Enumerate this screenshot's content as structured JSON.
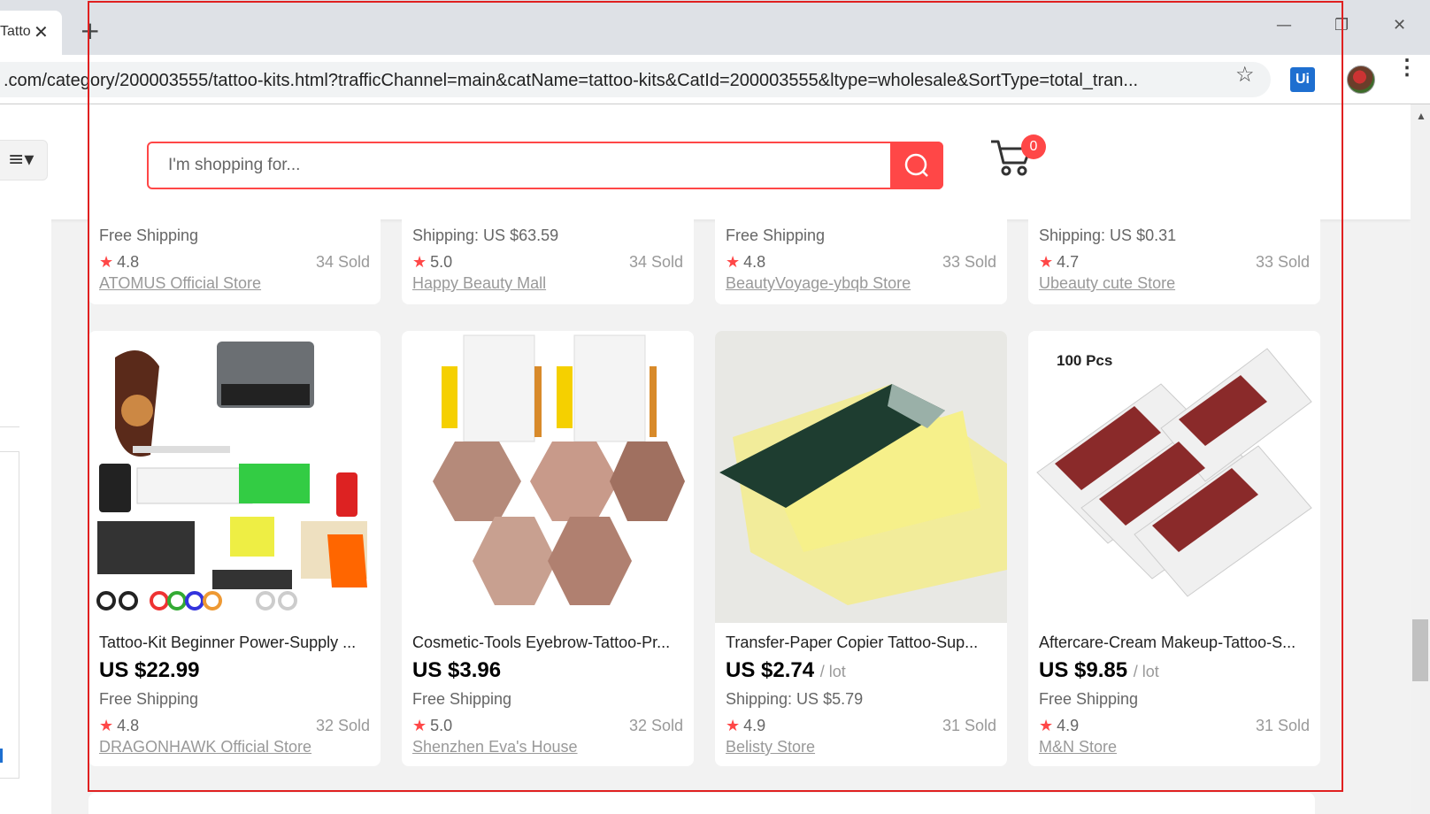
{
  "browser": {
    "tab_title": "Tatto",
    "tab_close": "✕",
    "new_tab": "+",
    "minimize": "—",
    "restore": "❐",
    "close": "✕",
    "url": ".com/category/200003555/tattoo-kits.html?trafficChannel=main&catName=tattoo-kits&CatId=200003555&ltype=wholesale&SortType=total_tran...",
    "bookmark_icon": "star-icon",
    "extension_label": "Ui",
    "menu": "⋮"
  },
  "header": {
    "category_menu_icon": "≡▾",
    "search_placeholder": "I'm shopping for...",
    "cart_count": "0"
  },
  "colors": {
    "accent": "#ff4747",
    "frame": "#e02020"
  },
  "top_cards": [
    {
      "shipping": "Free Shipping",
      "rating": "4.8",
      "sold": "34 Sold",
      "store": "ATOMUS Official Store"
    },
    {
      "shipping": "Shipping: US $63.59",
      "rating": "5.0",
      "sold": "34 Sold",
      "store": "Happy Beauty Mall"
    },
    {
      "shipping": "Free Shipping",
      "rating": "4.8",
      "sold": "33 Sold",
      "store": "BeautyVoyage-ybqb Store"
    },
    {
      "shipping": "Shipping: US $0.31",
      "rating": "4.7",
      "sold": "33 Sold",
      "store": "Ubeauty cute Store"
    }
  ],
  "cards": [
    {
      "title": "Tattoo-Kit Beginner Power-Supply ...",
      "price": "US $22.99",
      "unit": "",
      "shipping": "Free Shipping",
      "rating": "4.8",
      "sold": "32 Sold",
      "store": "DRAGONHAWK Official Store"
    },
    {
      "title": "Cosmetic-Tools Eyebrow-Tattoo-Pr...",
      "price": "US $3.96",
      "unit": "",
      "shipping": "Free Shipping",
      "rating": "5.0",
      "sold": "32 Sold",
      "store": "Shenzhen Eva's House"
    },
    {
      "title": "Transfer-Paper Copier Tattoo-Sup...",
      "price": "US $2.74",
      "unit": "/ lot",
      "shipping": "Shipping: US $5.79",
      "rating": "4.9",
      "sold": "31 Sold",
      "store": "Belisty Store"
    },
    {
      "title": "Aftercare-Cream Makeup-Tattoo-S...",
      "price": "US $9.85",
      "unit": "/ lot",
      "shipping": "Free Shipping",
      "rating": "4.9",
      "sold": "31 Sold",
      "store": "M&N Store",
      "image_label": "100 Pcs"
    }
  ],
  "star_glyph": "★"
}
